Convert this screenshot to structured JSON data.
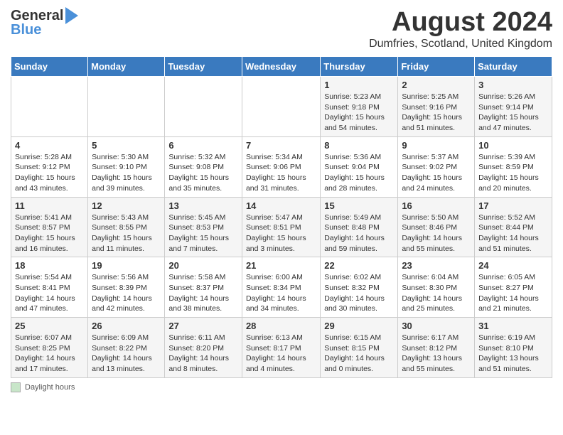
{
  "header": {
    "logo_general": "General",
    "logo_blue": "Blue",
    "title": "August 2024",
    "location": "Dumfries, Scotland, United Kingdom"
  },
  "calendar": {
    "days_of_week": [
      "Sunday",
      "Monday",
      "Tuesday",
      "Wednesday",
      "Thursday",
      "Friday",
      "Saturday"
    ],
    "weeks": [
      [
        {
          "day": "",
          "info": ""
        },
        {
          "day": "",
          "info": ""
        },
        {
          "day": "",
          "info": ""
        },
        {
          "day": "",
          "info": ""
        },
        {
          "day": "1",
          "info": "Sunrise: 5:23 AM\nSunset: 9:18 PM\nDaylight: 15 hours and 54 minutes."
        },
        {
          "day": "2",
          "info": "Sunrise: 5:25 AM\nSunset: 9:16 PM\nDaylight: 15 hours and 51 minutes."
        },
        {
          "day": "3",
          "info": "Sunrise: 5:26 AM\nSunset: 9:14 PM\nDaylight: 15 hours and 47 minutes."
        }
      ],
      [
        {
          "day": "4",
          "info": "Sunrise: 5:28 AM\nSunset: 9:12 PM\nDaylight: 15 hours and 43 minutes."
        },
        {
          "day": "5",
          "info": "Sunrise: 5:30 AM\nSunset: 9:10 PM\nDaylight: 15 hours and 39 minutes."
        },
        {
          "day": "6",
          "info": "Sunrise: 5:32 AM\nSunset: 9:08 PM\nDaylight: 15 hours and 35 minutes."
        },
        {
          "day": "7",
          "info": "Sunrise: 5:34 AM\nSunset: 9:06 PM\nDaylight: 15 hours and 31 minutes."
        },
        {
          "day": "8",
          "info": "Sunrise: 5:36 AM\nSunset: 9:04 PM\nDaylight: 15 hours and 28 minutes."
        },
        {
          "day": "9",
          "info": "Sunrise: 5:37 AM\nSunset: 9:02 PM\nDaylight: 15 hours and 24 minutes."
        },
        {
          "day": "10",
          "info": "Sunrise: 5:39 AM\nSunset: 8:59 PM\nDaylight: 15 hours and 20 minutes."
        }
      ],
      [
        {
          "day": "11",
          "info": "Sunrise: 5:41 AM\nSunset: 8:57 PM\nDaylight: 15 hours and 16 minutes."
        },
        {
          "day": "12",
          "info": "Sunrise: 5:43 AM\nSunset: 8:55 PM\nDaylight: 15 hours and 11 minutes."
        },
        {
          "day": "13",
          "info": "Sunrise: 5:45 AM\nSunset: 8:53 PM\nDaylight: 15 hours and 7 minutes."
        },
        {
          "day": "14",
          "info": "Sunrise: 5:47 AM\nSunset: 8:51 PM\nDaylight: 15 hours and 3 minutes."
        },
        {
          "day": "15",
          "info": "Sunrise: 5:49 AM\nSunset: 8:48 PM\nDaylight: 14 hours and 59 minutes."
        },
        {
          "day": "16",
          "info": "Sunrise: 5:50 AM\nSunset: 8:46 PM\nDaylight: 14 hours and 55 minutes."
        },
        {
          "day": "17",
          "info": "Sunrise: 5:52 AM\nSunset: 8:44 PM\nDaylight: 14 hours and 51 minutes."
        }
      ],
      [
        {
          "day": "18",
          "info": "Sunrise: 5:54 AM\nSunset: 8:41 PM\nDaylight: 14 hours and 47 minutes."
        },
        {
          "day": "19",
          "info": "Sunrise: 5:56 AM\nSunset: 8:39 PM\nDaylight: 14 hours and 42 minutes."
        },
        {
          "day": "20",
          "info": "Sunrise: 5:58 AM\nSunset: 8:37 PM\nDaylight: 14 hours and 38 minutes."
        },
        {
          "day": "21",
          "info": "Sunrise: 6:00 AM\nSunset: 8:34 PM\nDaylight: 14 hours and 34 minutes."
        },
        {
          "day": "22",
          "info": "Sunrise: 6:02 AM\nSunset: 8:32 PM\nDaylight: 14 hours and 30 minutes."
        },
        {
          "day": "23",
          "info": "Sunrise: 6:04 AM\nSunset: 8:30 PM\nDaylight: 14 hours and 25 minutes."
        },
        {
          "day": "24",
          "info": "Sunrise: 6:05 AM\nSunset: 8:27 PM\nDaylight: 14 hours and 21 minutes."
        }
      ],
      [
        {
          "day": "25",
          "info": "Sunrise: 6:07 AM\nSunset: 8:25 PM\nDaylight: 14 hours and 17 minutes."
        },
        {
          "day": "26",
          "info": "Sunrise: 6:09 AM\nSunset: 8:22 PM\nDaylight: 14 hours and 13 minutes."
        },
        {
          "day": "27",
          "info": "Sunrise: 6:11 AM\nSunset: 8:20 PM\nDaylight: 14 hours and 8 minutes."
        },
        {
          "day": "28",
          "info": "Sunrise: 6:13 AM\nSunset: 8:17 PM\nDaylight: 14 hours and 4 minutes."
        },
        {
          "day": "29",
          "info": "Sunrise: 6:15 AM\nSunset: 8:15 PM\nDaylight: 14 hours and 0 minutes."
        },
        {
          "day": "30",
          "info": "Sunrise: 6:17 AM\nSunset: 8:12 PM\nDaylight: 13 hours and 55 minutes."
        },
        {
          "day": "31",
          "info": "Sunrise: 6:19 AM\nSunset: 8:10 PM\nDaylight: 13 hours and 51 minutes."
        }
      ]
    ]
  },
  "footer": {
    "daylight_label": "Daylight hours"
  }
}
